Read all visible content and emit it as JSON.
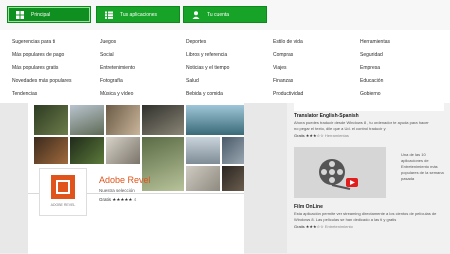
{
  "nav": {
    "buttons": [
      {
        "label": "Principal",
        "icon": "home-grid-icon"
      },
      {
        "label": "Tus aplicaciones",
        "icon": "apps-list-icon"
      },
      {
        "label": "Tu cuenta",
        "icon": "user-icon"
      }
    ],
    "accent": "#17a327"
  },
  "menu": {
    "columns": [
      [
        "Sugerencias para ti",
        "Más populares de pago",
        "Más populares gratis",
        "Novedades más populares",
        "Tendencias"
      ],
      [
        "Juegos",
        "Social",
        "Entretenimiento",
        "Fotografía",
        "Música y vídeo"
      ],
      [
        "Deportes",
        "Libros y referencia",
        "Noticias y el tiempo",
        "Salud",
        "Bebida y comida"
      ],
      [
        "Estilo de vida",
        "Compras",
        "Viajes",
        "Finanzas",
        "Productividad"
      ],
      [
        "Herramientas",
        "Seguridad",
        "Empresa",
        "Educación",
        "Gobierno"
      ]
    ]
  },
  "featured": {
    "app_name": "Adobe Revel",
    "subtitle": "Nuestra selección",
    "price": "Gratis",
    "stars": "★★★★★",
    "count": "4",
    "tile_caption": "ADOBE REVEL",
    "brand_color": "#e0541b"
  },
  "right": {
    "translator": {
      "title": "Translator English-Spanish",
      "desc": "Ahora puedes traducir desde Windows 8 , tu ordenador te ayuda para hacer no pegar el texto, dile que a Ud. el control traducir y",
      "price": "Gratis",
      "stars": "★★★☆☆",
      "category": "Herramientas"
    },
    "film": {
      "title": "Film OnLine",
      "desc": "Esta aplicación permite ver streaming directamente a los cientos de películas de Windows 8. Las películas se han dedicado a las ti y gratis",
      "price": "Gratis",
      "stars": "★★★☆☆",
      "category": "Entretenimiento",
      "note": "Una de las 10 aplicaciones de Entretenimiento más populares de la semana pasada",
      "note_link": "de la semana pasada"
    }
  }
}
